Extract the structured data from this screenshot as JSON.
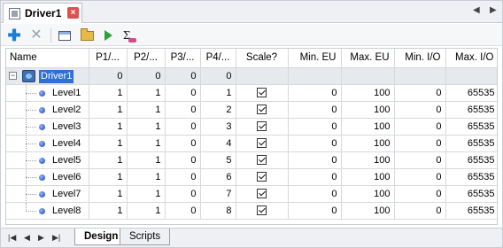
{
  "document_tab": {
    "title": "Driver1",
    "close_glyph": "×"
  },
  "strip_nav": {
    "prev": "◀",
    "next": "▶"
  },
  "toolbar": {
    "add_icon": "✚",
    "delete_icon": "✕",
    "sigma_icon": "Σ"
  },
  "grid": {
    "columns": [
      "Name",
      "P1/...",
      "P2/...",
      "P3/...",
      "P4/...",
      "Scale?",
      "Min. EU",
      "Max. EU",
      "Min. I/O",
      "Max. I/O"
    ],
    "root": {
      "name": "Driver1",
      "expander": "−",
      "p1": "0",
      "p2": "0",
      "p3": "0",
      "p4": "0"
    },
    "rows": [
      {
        "name": "Level1",
        "p1": "1",
        "p2": "1",
        "p3": "0",
        "p4": "1",
        "min_eu": "0",
        "max_eu": "100",
        "min_io": "0",
        "max_io": "65535"
      },
      {
        "name": "Level2",
        "p1": "1",
        "p2": "1",
        "p3": "0",
        "p4": "2",
        "min_eu": "0",
        "max_eu": "100",
        "min_io": "0",
        "max_io": "65535"
      },
      {
        "name": "Level3",
        "p1": "1",
        "p2": "1",
        "p3": "0",
        "p4": "3",
        "min_eu": "0",
        "max_eu": "100",
        "min_io": "0",
        "max_io": "65535"
      },
      {
        "name": "Level4",
        "p1": "1",
        "p2": "1",
        "p3": "0",
        "p4": "4",
        "min_eu": "0",
        "max_eu": "100",
        "min_io": "0",
        "max_io": "65535"
      },
      {
        "name": "Level5",
        "p1": "1",
        "p2": "1",
        "p3": "0",
        "p4": "5",
        "min_eu": "0",
        "max_eu": "100",
        "min_io": "0",
        "max_io": "65535"
      },
      {
        "name": "Level6",
        "p1": "1",
        "p2": "1",
        "p3": "0",
        "p4": "6",
        "min_eu": "0",
        "max_eu": "100",
        "min_io": "0",
        "max_io": "65535"
      },
      {
        "name": "Level7",
        "p1": "1",
        "p2": "1",
        "p3": "0",
        "p4": "7",
        "min_eu": "0",
        "max_eu": "100",
        "min_io": "0",
        "max_io": "65535"
      },
      {
        "name": "Level8",
        "p1": "1",
        "p2": "1",
        "p3": "0",
        "p4": "8",
        "min_eu": "0",
        "max_eu": "100",
        "min_io": "0",
        "max_io": "65535"
      }
    ]
  },
  "bottom": {
    "nav": [
      "|◀",
      "◀",
      "▶",
      "▶|"
    ],
    "tabs": [
      "Design",
      "Scripts"
    ]
  },
  "colors": {
    "selection": "#2f6fd6",
    "root_row": "#e6e9ed",
    "add_icon": "#1b7fd6"
  }
}
